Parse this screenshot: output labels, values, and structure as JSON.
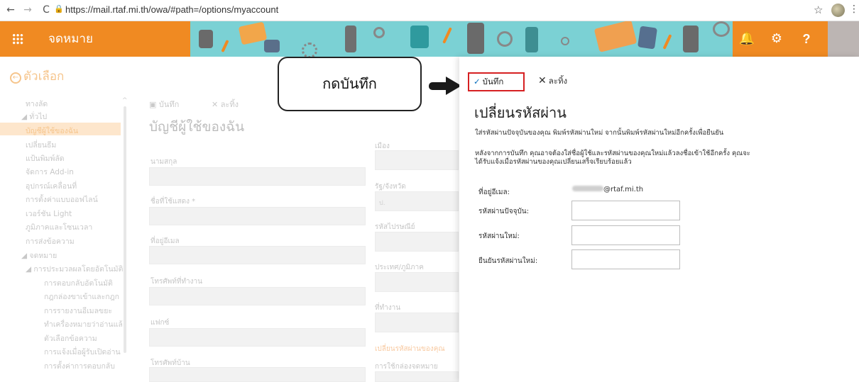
{
  "browser": {
    "url": "https://mail.rtaf.mi.th/owa/#path=/options/myaccount",
    "back": "←",
    "forward": "→",
    "reload": "C",
    "star": "☆",
    "kebab": "⋮"
  },
  "header": {
    "app_title": "จดหมาย",
    "colors": {
      "orange": "#f08a22",
      "banner": "#7bd1d4"
    }
  },
  "left_nav": {
    "back_title": "ตัวเลือก",
    "shortcuts": "ทางลัด",
    "general": "◢ ทั่วไป",
    "general_items": [
      "บัญชีผู้ใช้ของฉัน",
      "เปลี่ยนธีม",
      "แป้นพิมพ์ลัด",
      "จัดการ Add-in",
      "อุปกรณ์เคลื่อนที่",
      "การตั้งค่าแบบออฟไลน์",
      "เวอร์ชัน Light",
      "ภูมิภาคและโซนเวลา",
      "การส่งข้อความ"
    ],
    "mail": "◢ จดหมาย",
    "mail_sub": "◢ การประมวลผลโดยอัตโนมัติ",
    "mail_items": [
      "การตอบกลับอัตโนมัติ",
      "กฎกล่องขาเข้าและกฎก",
      "การรายงานอีเมลขยะ",
      "ทำเครื่องหมายว่าอ่านแล้",
      "ตัวเลือกข้อความ",
      "การแจ้งเมื่อผู้รับเปิดอ่าน",
      "การตั้งค่าการตอบกลับ"
    ]
  },
  "middle_form": {
    "save": "บันทึก",
    "discard": "ละทิ้ง",
    "title": "บัญชีผู้ใช้ของฉัน",
    "labels": [
      "นามสกุล",
      "ชื่อที่ใช้แสดง *",
      "ที่อยู่อีเมล",
      "โทรศัพท์ที่ทำงาน",
      "แฟกซ์",
      "โทรศัพท์บ้าน"
    ],
    "right_labels": [
      "เมือง",
      "รัฐ/จังหวัด",
      "รหัสไปรษณีย์",
      "ประเทศ/ภูมิภาค",
      "ที่ทำงาน"
    ],
    "state_value": "ป.",
    "change_password_link": "เปลี่ยนรหัสผ่านของคุณ",
    "mailbox_usage": "การใช้กล่องจดหมาย"
  },
  "callout": {
    "text": "กดบันทึก"
  },
  "panel": {
    "save_label": "บันทึก",
    "discard_label": "ละทิ้ง",
    "title": "เปลี่ยนรหัสผ่าน",
    "desc1": "ใส่รหัสผ่านปัจจุบันของคุณ พิมพ์รหัสผ่านใหม่ จากนั้นพิมพ์รหัสผ่านใหม่อีกครั้งเพื่อยืนยัน",
    "desc2": "หลังจากการบันทึก คุณอาจต้องใส่ชื่อผู้ใช้และรหัสผ่านของคุณใหม่แล้วลงชื่อเข้าใช้อีกครั้ง คุณจะ",
    "desc3": "ได้รับแจ้งเมื่อรหัสผ่านของคุณเปลี่ยนเสร็จเรียบร้อยแล้ว",
    "email_label": "ที่อยู่อีเมล:",
    "email_domain": "@rtaf.mi.th",
    "current_pw_label": "รหัสผ่านปัจจุบัน:",
    "new_pw_label": "รหัสผ่านใหม่:",
    "confirm_pw_label": "ยืนยันรหัสผ่านใหม่:",
    "current_pw_value": "",
    "new_pw_value": "",
    "confirm_pw_value": "",
    "highlight_color": "#d62022"
  }
}
